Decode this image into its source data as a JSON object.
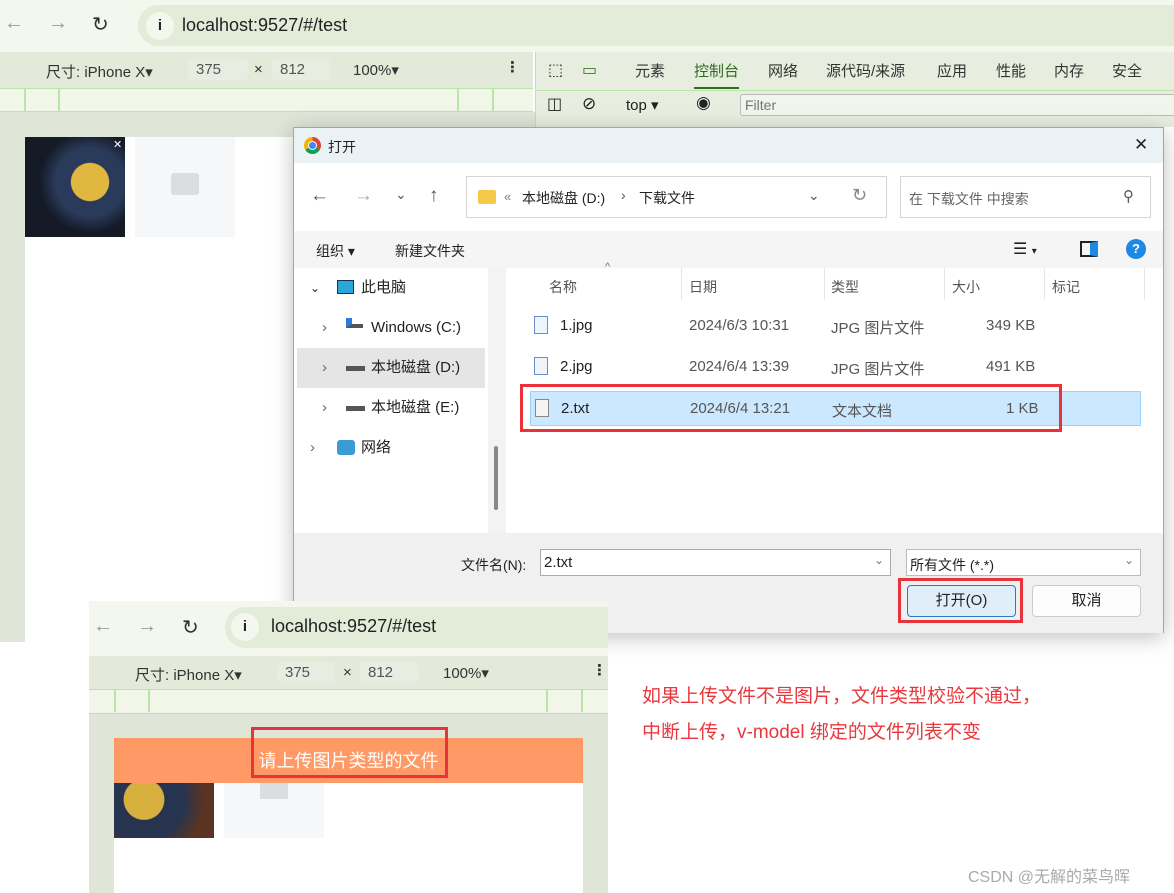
{
  "browser": {
    "url": "localhost:9527/#/test",
    "device": "尺寸: iPhone X",
    "width": "375",
    "times": "×",
    "height": "812",
    "zoom": "100%"
  },
  "devtools": {
    "tabs": [
      "元素",
      "控制台",
      "网络",
      "源代码/来源",
      "应用",
      "性能",
      "内存",
      "安全"
    ],
    "active_tab": "控制台",
    "context": "top",
    "filter_placeholder": "Filter"
  },
  "dialog": {
    "title": "打开",
    "path_prefix": "«",
    "path": [
      "本地磁盘 (D:)",
      "下载文件"
    ],
    "search_placeholder": "在 下载文件 中搜索",
    "organize": "组织",
    "new_folder": "新建文件夹",
    "nav": [
      {
        "label": "此电脑",
        "expanded": true
      },
      {
        "label": "Windows  (C:)"
      },
      {
        "label": "本地磁盘 (D:)",
        "selected": true
      },
      {
        "label": "本地磁盘 (E:)"
      },
      {
        "label": "网络"
      }
    ],
    "columns": [
      "名称",
      "日期",
      "类型",
      "大小",
      "标记"
    ],
    "files": [
      {
        "name": "1.jpg",
        "date": "2024/6/3 10:31",
        "type": "JPG 图片文件",
        "size": "349 KB"
      },
      {
        "name": "2.jpg",
        "date": "2024/6/4 13:39",
        "type": "JPG 图片文件",
        "size": "491 KB"
      },
      {
        "name": "2.txt",
        "date": "2024/6/4 13:21",
        "type": "文本文档",
        "size": "1 KB",
        "selected": true
      }
    ],
    "filename_label": "文件名(N):",
    "filename": "2.txt",
    "filetype": "所有文件 (*.*)",
    "open": "打开(O)",
    "cancel": "取消"
  },
  "toast": "请上传图片类型的文件",
  "annotation": [
    "如果上传文件不是图片，文件类型校验不通过，",
    "中断上传，v-model 绑定的文件列表不变"
  ],
  "watermark": "CSDN @无解的菜鸟晖",
  "colors": {
    "accent_red": "#e8383d",
    "toast_bg": "#ff9966",
    "selected_row": "#cce8ff"
  }
}
